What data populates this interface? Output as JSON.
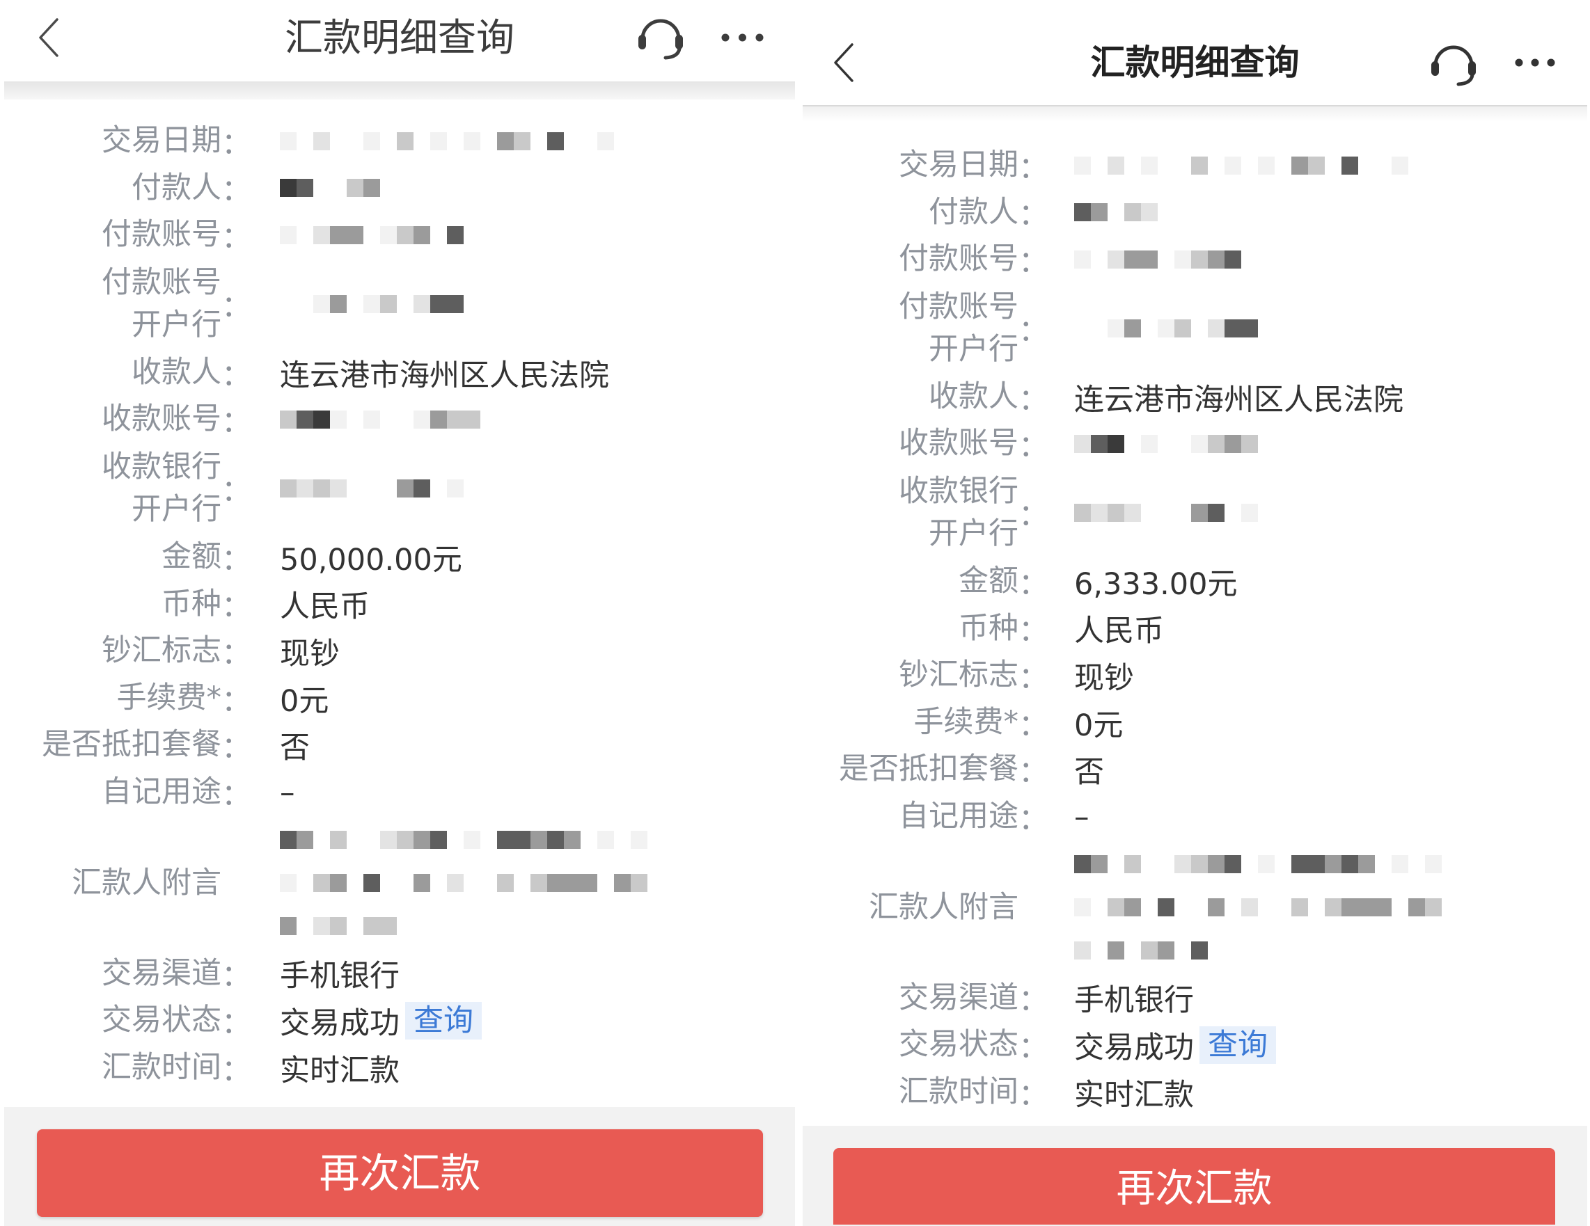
{
  "panels": [
    {
      "header": {
        "title": "汇款明细查询",
        "icons": {
          "back": "chevron-left-icon",
          "service": "headset-icon",
          "more": "more-dots-icon"
        }
      },
      "rows": [
        {
          "label": [
            "交易日期"
          ],
          "colon": "：",
          "value": null,
          "redacted": true
        },
        {
          "label": [
            "付款人"
          ],
          "colon": "：",
          "value": null,
          "redacted": true
        },
        {
          "label": [
            "付款账号"
          ],
          "colon": "：",
          "value": null,
          "redacted": true
        },
        {
          "label": [
            "付款账号",
            "开户行"
          ],
          "colon": "：",
          "value": null,
          "redacted": true
        },
        {
          "label": [
            "收款人"
          ],
          "colon": "：",
          "value": "连云港市海州区人民法院"
        },
        {
          "label": [
            "收款账号"
          ],
          "colon": "：",
          "value": null,
          "redacted": true
        },
        {
          "label": [
            "收款银行",
            "开户行"
          ],
          "colon": "：",
          "value": null,
          "redacted": true
        },
        {
          "label": [
            "金额"
          ],
          "colon": "：",
          "value": "50,000.00元"
        },
        {
          "label": [
            "币种"
          ],
          "colon": "：",
          "value": "人民币"
        },
        {
          "label": [
            "钞汇标志"
          ],
          "colon": "：",
          "value": "现钞"
        },
        {
          "label": [
            "手续费*"
          ],
          "colon": "：",
          "value": "0元"
        },
        {
          "label": [
            "是否抵扣套餐"
          ],
          "colon": "：",
          "value": "否"
        },
        {
          "label": [
            "自记用途"
          ],
          "colon": "：",
          "value": "–"
        },
        {
          "label": [
            "汇款人附言"
          ],
          "colon": "",
          "value": null,
          "redacted": true
        },
        {
          "label": [
            "交易渠道"
          ],
          "colon": "：",
          "value": "手机银行"
        },
        {
          "label": [
            "交易状态"
          ],
          "colon": "：",
          "value": "交易成功",
          "link": "查询"
        },
        {
          "label": [
            "汇款时间"
          ],
          "colon": "：",
          "value": "实时汇款"
        }
      ],
      "button": {
        "label": "再次汇款"
      }
    },
    {
      "header": {
        "title": "汇款明细查询",
        "icons": {
          "back": "chevron-left-icon",
          "service": "headset-icon",
          "more": "more-dots-icon"
        }
      },
      "rows": [
        {
          "label": [
            "交易日期"
          ],
          "colon": "：",
          "value": null,
          "redacted": true
        },
        {
          "label": [
            "付款人"
          ],
          "colon": "：",
          "value": null,
          "redacted": true
        },
        {
          "label": [
            "付款账号"
          ],
          "colon": "：",
          "value": null,
          "redacted": true
        },
        {
          "label": [
            "付款账号",
            "开户行"
          ],
          "colon": "：",
          "value": null,
          "redacted": true
        },
        {
          "label": [
            "收款人"
          ],
          "colon": "：",
          "value": "连云港市海州区人民法院"
        },
        {
          "label": [
            "收款账号"
          ],
          "colon": "：",
          "value": null,
          "redacted": true
        },
        {
          "label": [
            "收款银行",
            "开户行"
          ],
          "colon": "：",
          "value": null,
          "redacted": true
        },
        {
          "label": [
            "金额"
          ],
          "colon": "：",
          "value": "6,333.00元"
        },
        {
          "label": [
            "币种"
          ],
          "colon": "：",
          "value": "人民币"
        },
        {
          "label": [
            "钞汇标志"
          ],
          "colon": "：",
          "value": "现钞"
        },
        {
          "label": [
            "手续费*"
          ],
          "colon": "：",
          "value": "0元"
        },
        {
          "label": [
            "是否抵扣套餐"
          ],
          "colon": "：",
          "value": "否"
        },
        {
          "label": [
            "自记用途"
          ],
          "colon": "：",
          "value": "–"
        },
        {
          "label": [
            "汇款人附言"
          ],
          "colon": "",
          "value": null,
          "redacted": true
        },
        {
          "label": [
            "交易渠道"
          ],
          "colon": "：",
          "value": "手机银行"
        },
        {
          "label": [
            "交易状态"
          ],
          "colon": "：",
          "value": "交易成功",
          "link": "查询"
        },
        {
          "label": [
            "汇款时间"
          ],
          "colon": "：",
          "value": "实时汇款"
        }
      ],
      "button": {
        "label": "再次汇款"
      }
    }
  ],
  "colors": {
    "button_red": "#e85a53",
    "link_blue": "#3c7ad6",
    "link_background": "#e8f0fb",
    "label_gray": "#8e939b",
    "value_text": "#333333",
    "footer_gray": "#f2f2f2"
  }
}
